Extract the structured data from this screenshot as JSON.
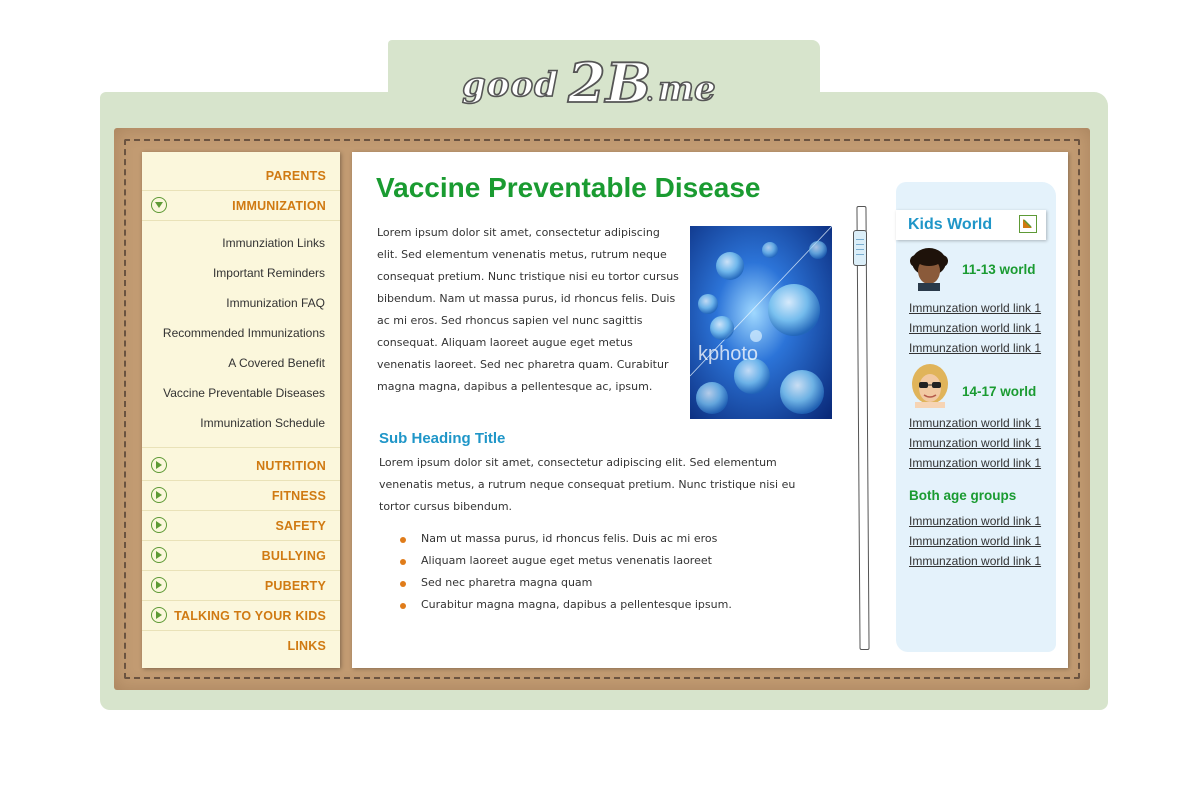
{
  "logo": {
    "text": "good2B.me"
  },
  "nav": {
    "parents": "PARENTS",
    "immunization": {
      "label": "IMMUNIZATION",
      "sub_items": [
        "Immunziation Links",
        "Important Reminders",
        "Immunization FAQ",
        "Recommended Immunizations",
        "A Covered Benefit",
        "Vaccine Preventable Diseases",
        "Immunization Schedule"
      ]
    },
    "items": [
      "NUTRITION",
      "FITNESS",
      "SAFETY",
      "BULLYING",
      "PUBERTY",
      "TALKING TO YOUR KIDS"
    ],
    "links": "LINKS"
  },
  "main": {
    "title": "Vaccine Preventable Disease",
    "para1": "Lorem ipsum dolor sit amet, consectetur adipiscing elit. Sed elementum venenatis metus, rutrum neque consequat pretium. Nunc tristique nisi eu tortor cursus bibendum. Nam ut massa purus, id rhoncus felis. Duis ac mi eros. Sed rhoncus sapien vel nunc sagittis consequat. Aliquam laoreet augue eget metus venenatis laoreet. Sed nec pharetra quam. Curabitur magna magna, dapibus a pellentesque ac, ipsum.",
    "photo_watermark": "kphoto",
    "subheading": "Sub Heading Title",
    "para2": "Lorem ipsum dolor sit amet, consectetur adipiscing elit. Sed elementum venenatis metus, a rutrum neque consequat pretium. Nunc tristique nisi eu tortor cursus bibendum.",
    "bullets": [
      "Nam ut massa purus, id rhoncus felis. Duis ac mi eros",
      "Aliquam laoreet augue eget metus venenatis laoreet",
      "Sed nec pharetra magna quam",
      "Curabitur magna magna, dapibus a pellentesque ipsum."
    ]
  },
  "kids": {
    "title": "Kids World",
    "group1": {
      "title": "11-13 world",
      "links": [
        "Immunzation world link 1",
        "Immunzation world link 1",
        "Immunzation world link 1"
      ]
    },
    "group2": {
      "title": "14-17 world",
      "links": [
        "Immunzation world link 1",
        "Immunzation world link 1",
        "Immunzation world link 1"
      ]
    },
    "group3": {
      "title": "Both age groups",
      "links": [
        "Immunzation world link 1",
        "Immunzation world link 1",
        "Immunzation world link 1"
      ]
    }
  },
  "colors": {
    "nav_orange": "#d07a12",
    "title_green": "#1a9b31",
    "subhead_blue": "#1f96c8",
    "bullet_orange": "#e07c1a",
    "cardboard": "#c29b72",
    "frame_green": "#d7e4cc"
  }
}
